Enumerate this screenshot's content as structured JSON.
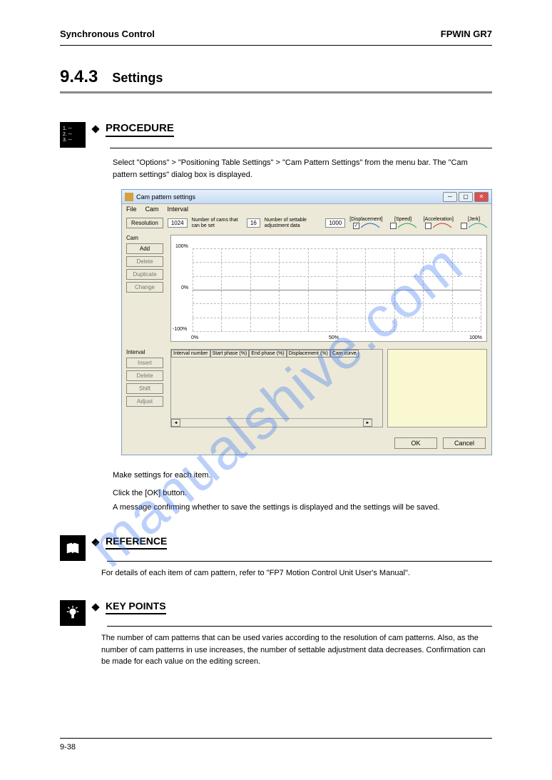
{
  "page": {
    "header_left": "Synchronous Control",
    "header_right": "FPWIN GR7",
    "footer_page": "9-38"
  },
  "section": {
    "number": "9.4.3",
    "title": "Settings"
  },
  "procedure": {
    "label": "PROCEDURE",
    "text": "Select \"Options\" > \"Positioning Table Settings\" > \"Cam Pattern Settings\" from the menu bar. The \"Cam pattern settings\" dialog box is displayed."
  },
  "window": {
    "title": "Cam pattern settings",
    "menu": [
      "File",
      "Cam",
      "Interval"
    ],
    "resolution_btn": "Resolution",
    "resolution_val": "1024",
    "num_cams_label": "Number of cams that can be set",
    "num_cams_val": "16",
    "num_settable_label": "Number of settable adjustment data",
    "num_settable_val": "1000",
    "legend": {
      "displacement": "[Displacement]",
      "speed": "[Speed]",
      "acceleration": "[Acceleration]",
      "jerk": "[Jerk]"
    },
    "cam_panel": {
      "title": "Cam",
      "buttons": [
        "Add",
        "Delete",
        "Duplicate",
        "Change"
      ]
    },
    "interval_panel": {
      "title": "Interval",
      "buttons": [
        "Insert",
        "Delete",
        "Shift",
        "Adjust"
      ]
    },
    "table_headers": [
      "Interval number",
      "Start phase (%)",
      "End phase (%)",
      "Displacement (%)",
      "Cam curve"
    ],
    "chart": {
      "y100": "100%",
      "y0": "0%",
      "yn100": "-100%",
      "x0": "0%",
      "x50": "50%",
      "x100": "100%"
    },
    "ok": "OK",
    "cancel": "Cancel"
  },
  "chart_data": {
    "type": "line",
    "title": "",
    "xlabel": "",
    "ylabel": "",
    "xlim": [
      0,
      100
    ],
    "ylim": [
      -100,
      100
    ],
    "x_ticks": [
      0,
      50,
      100
    ],
    "y_ticks": [
      -100,
      0,
      100
    ],
    "series": []
  },
  "after_text": {
    "line1": "Make settings for each item.",
    "line2": "Click the [OK] button.",
    "line3": "A message confirming whether to save the settings is displayed and the settings will be saved."
  },
  "reference": {
    "label": "REFERENCE",
    "text": "For details of each item of cam pattern, refer to \"FP7 Motion Control Unit User's Manual\"."
  },
  "keypoints": {
    "label": "KEY POINTS",
    "text": "The number of cam patterns that can be used varies according to the resolution of cam patterns. Also, as the number of cam patterns in use increases, the number of settable adjustment data decreases. Confirmation can be made for each value on the editing screen."
  },
  "watermark": "manualshive.com"
}
